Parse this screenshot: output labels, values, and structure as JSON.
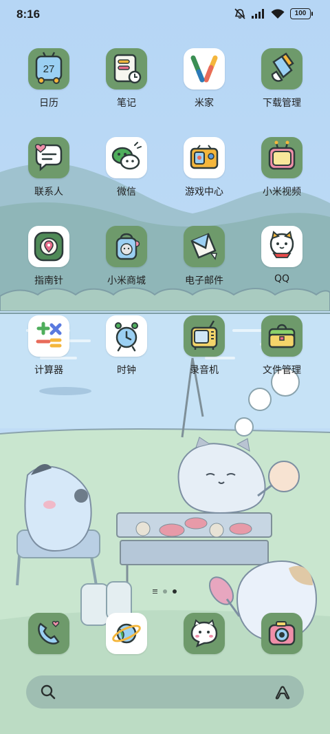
{
  "status_bar": {
    "time": "8:16",
    "battery_level": "100",
    "icons": [
      "mute-icon",
      "signal-icon",
      "wifi-icon",
      "battery-icon"
    ]
  },
  "apps": [
    {
      "label": "日历",
      "icon": "calendar-icon",
      "calendar_day": "27"
    },
    {
      "label": "笔记",
      "icon": "notes-icon"
    },
    {
      "label": "米家",
      "icon": "mijia-icon"
    },
    {
      "label": "下载管理",
      "icon": "download-manager-icon"
    },
    {
      "label": "联系人",
      "icon": "contacts-icon"
    },
    {
      "label": "微信",
      "icon": "wechat-icon"
    },
    {
      "label": "游戏中心",
      "icon": "game-center-icon"
    },
    {
      "label": "小米视频",
      "icon": "video-icon"
    },
    {
      "label": "指南针",
      "icon": "compass-icon"
    },
    {
      "label": "小米商城",
      "icon": "store-icon"
    },
    {
      "label": "电子邮件",
      "icon": "email-icon"
    },
    {
      "label": "QQ",
      "icon": "qq-icon"
    },
    {
      "label": "计算器",
      "icon": "calculator-icon"
    },
    {
      "label": "时钟",
      "icon": "clock-icon"
    },
    {
      "label": "录音机",
      "icon": "recorder-icon"
    },
    {
      "label": "文件管理",
      "icon": "file-manager-icon"
    }
  ],
  "dock": [
    {
      "icon": "phone-icon"
    },
    {
      "icon": "browser-icon"
    },
    {
      "icon": "messages-icon"
    },
    {
      "icon": "camera-icon"
    }
  ],
  "page_indicator": {
    "pages": 2,
    "current": 2
  },
  "search_bar": {
    "left_icon": "search-icon",
    "right_icon": "assistant-icon"
  },
  "colors": {
    "tile_green": "#6e9a6b",
    "sky": "#b9d9f4",
    "grass": "#c9e6cf"
  }
}
